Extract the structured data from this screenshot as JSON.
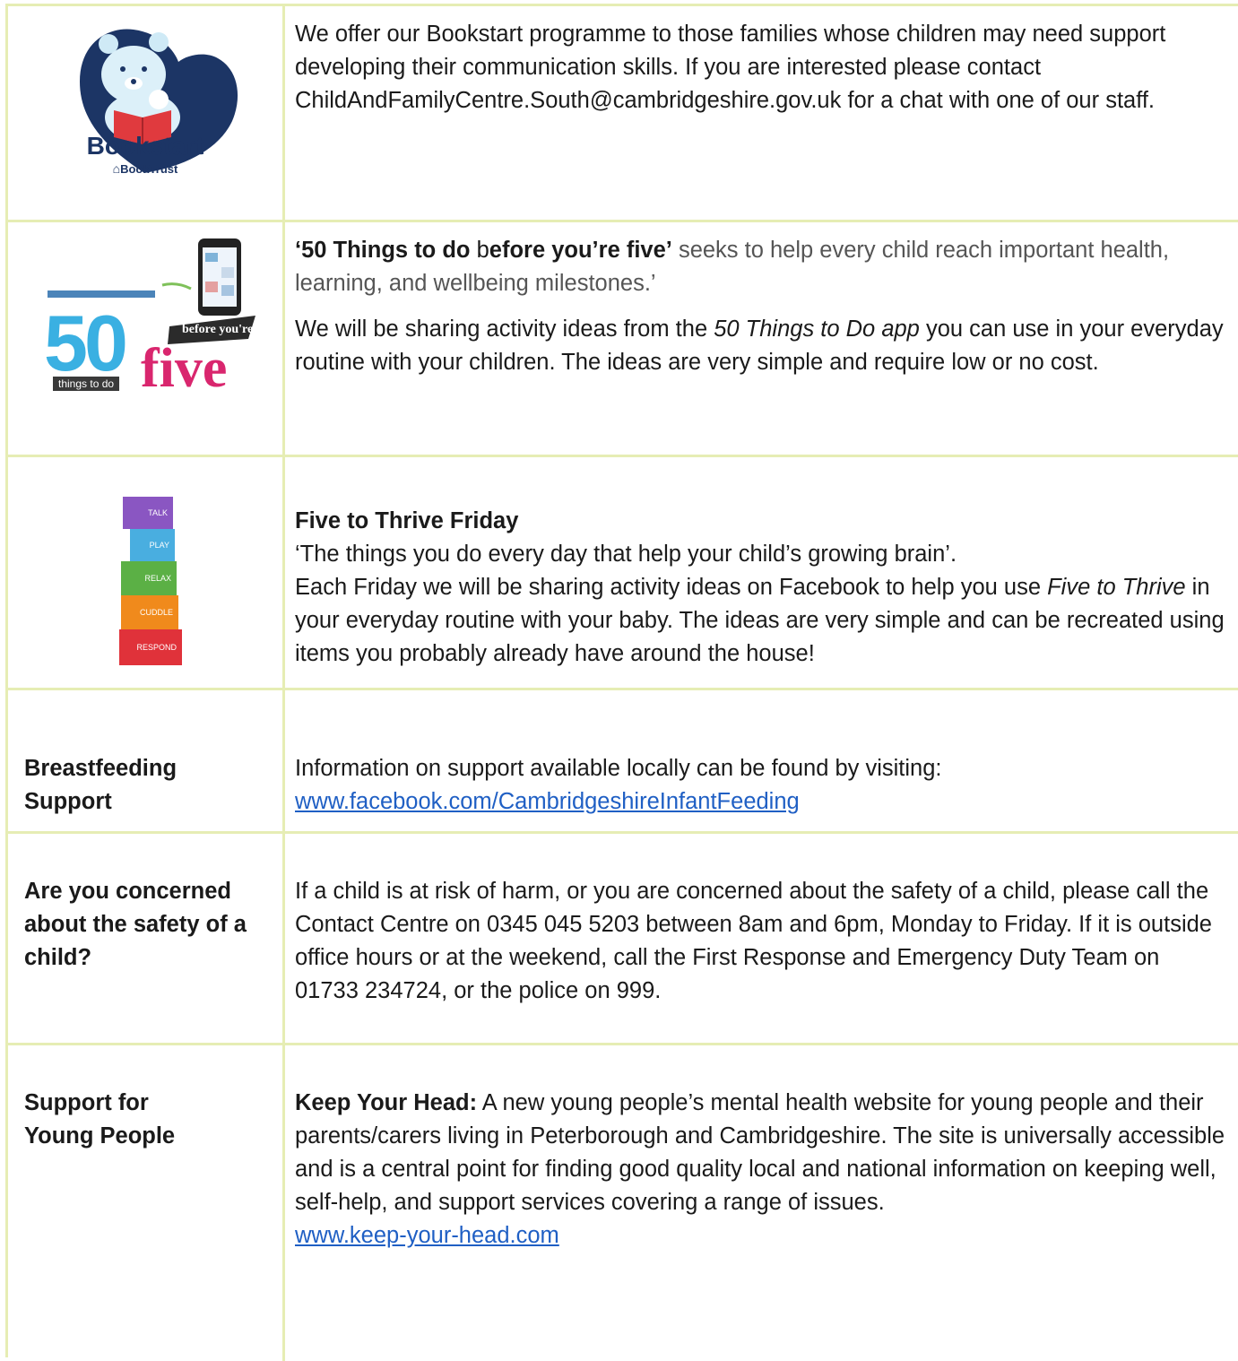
{
  "rows": {
    "bookstart": {
      "logo_title": "Bookstart",
      "logo_sub": "BookTrust",
      "text": "We offer our Bookstart programme to those families whose children may need support developing their communication skills. If you are interested please contact ChildAndFamilyCentre.South@cambridgeshire.gov.uk for a chat with one of our staff."
    },
    "fifty": {
      "logo_num": "50",
      "logo_things": "things to do",
      "logo_before": "before you're",
      "logo_five": "five",
      "p1_bold": "‘50 Things to do",
      "p1_mid": " b",
      "p1_bold2": "efore you’re five’",
      "p1_rest": " seeks to help every child reach important health, learning, and wellbeing milestones.’",
      "p2_start": "We will be sharing activity ideas from the ",
      "p2_italic": "50 Things to Do app",
      "p2_end": " you can use in your everyday routine with your children. The ideas are very simple and require low or no cost."
    },
    "thrive": {
      "cubes": [
        "TALK",
        "PLAY",
        "RELAX",
        "CUDDLE",
        "RESPOND"
      ],
      "title": "Five to Thrive Friday",
      "line1": "‘The things you do every day that help your child’s growing brain’.",
      "line2_start": "Each Friday we will be sharing activity ideas on Facebook to help you use ",
      "line2_italic": "Five to Thrive",
      "line2_end": " in your everyday routine with your baby. The ideas are very simple and can be recreated using items you probably already have around the house!"
    },
    "breastfeeding": {
      "label": "Breastfeeding Support",
      "text": "Information on support available locally can be found by visiting:",
      "link": "www.facebook.com/CambridgeshireInfantFeeding"
    },
    "safety": {
      "label": "Are you concerned about the safety of a child?",
      "text": "If a child is at risk of harm, or you are concerned about the safety of a child, please call the Contact Centre on 0345 045 5203 between 8am and 6pm, Monday to Friday. If it is outside office hours or at the weekend, call the First Response and Emergency Duty Team on 01733 234724, or the police on 999."
    },
    "young": {
      "label": "Support for Young People",
      "bold": "Keep Your Head:",
      "text": " A new young people’s mental health website for young people and their parents/carers living in Peterborough and Cambridgeshire. The site is universally accessible and is a central point for finding good quality local and national information on keeping well, self-help, and support services covering a range of issues.",
      "link": "www.keep-your-head.com"
    }
  }
}
